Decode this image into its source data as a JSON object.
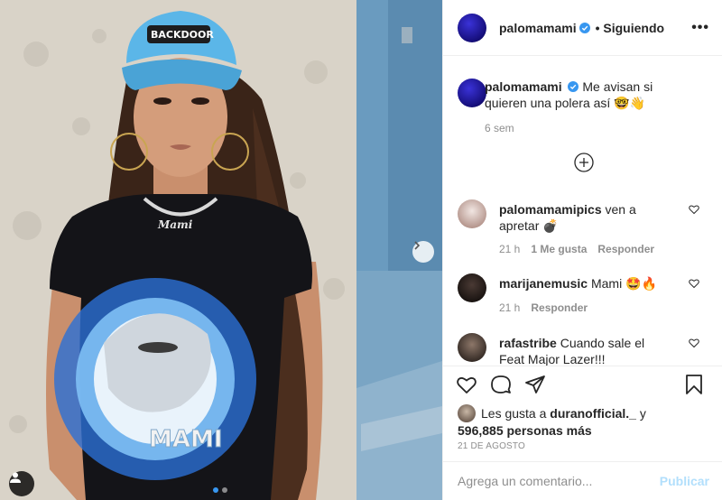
{
  "photo": {
    "cap_logo_text": "BACKDOOR",
    "necklace_text": "Mami",
    "shirt_text": "MAMI",
    "carousel_dots": 2,
    "active_dot": 0
  },
  "header": {
    "username": "palomamami",
    "separator": "•",
    "following": "Siguiendo",
    "more": "•••"
  },
  "caption": {
    "username": "palomamami",
    "text": "Me avisan si quieren una polera así 🤓👋",
    "time": "6 sem"
  },
  "comments": [
    {
      "username": "palomamamipics",
      "text": "ven a apretar 💣",
      "time": "21 h",
      "likes": "1 Me gusta",
      "reply": "Responder"
    },
    {
      "username": "marijanemusic",
      "text": "Mami 🤩🔥",
      "time": "21 h",
      "likes": "",
      "reply": "Responder"
    },
    {
      "username": "rafastribe",
      "text": "Cuando sale el Feat Major Lazer!!!",
      "time": "",
      "likes": "",
      "reply": ""
    }
  ],
  "likes": {
    "prefix": "Les gusta a",
    "user": "duranofficial._",
    "joiner": "y",
    "count": "596,885 personas más"
  },
  "date": "21 DE AGOSTO",
  "comment_box": {
    "placeholder": "Agrega un comentario...",
    "post_label": "Publicar"
  },
  "colors": {
    "accent": "#3897f0",
    "post_disabled": "#b2dffc",
    "meta": "#8e8e8e",
    "cap_blue": "#5bb6e8"
  }
}
